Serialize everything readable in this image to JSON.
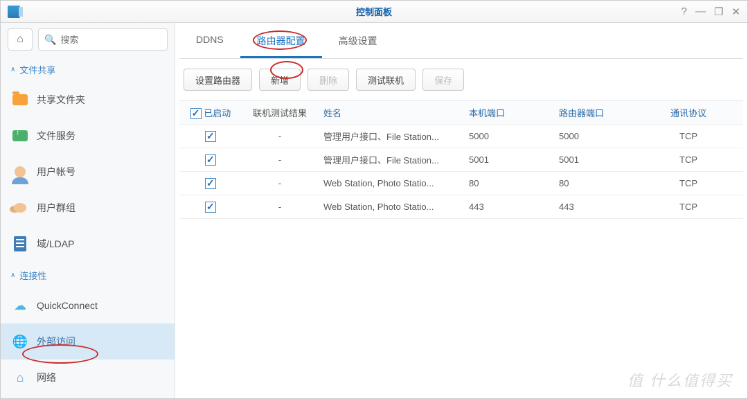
{
  "window": {
    "title": "控制面板"
  },
  "titlebar_icons": {
    "help": "?",
    "minimize": "—",
    "maximize": "❐",
    "close": "✕"
  },
  "sidebar": {
    "search_placeholder": "搜索",
    "section1": "文件共享",
    "items1": [
      {
        "label": "共享文件夹"
      },
      {
        "label": "文件服务"
      },
      {
        "label": "用户帐号"
      },
      {
        "label": "用户群组"
      },
      {
        "label": "域/LDAP"
      }
    ],
    "section2": "连接性",
    "items2": [
      {
        "label": "QuickConnect"
      },
      {
        "label": "外部访问",
        "active": true
      },
      {
        "label": "网络"
      }
    ]
  },
  "tabs": [
    {
      "label": "DDNS"
    },
    {
      "label": "路由器配置",
      "active": true
    },
    {
      "label": "高级设置"
    }
  ],
  "toolbar": {
    "setup": "设置路由器",
    "add": "新增",
    "delete": "删除",
    "test": "测试联机",
    "save": "保存"
  },
  "columns": {
    "enabled": "已启动",
    "test_result": "联机测试结果",
    "name": "姓名",
    "local_port": "本机端口",
    "router_port": "路由器端口",
    "protocol": "通讯协议"
  },
  "rows": [
    {
      "enabled": true,
      "test": "-",
      "name": "管理用户接口、File Station...",
      "lport": "5000",
      "rport": "5000",
      "proto": "TCP"
    },
    {
      "enabled": true,
      "test": "-",
      "name": "管理用户接口、File Station...",
      "lport": "5001",
      "rport": "5001",
      "proto": "TCP"
    },
    {
      "enabled": true,
      "test": "-",
      "name": "Web Station, Photo Statio...",
      "lport": "80",
      "rport": "80",
      "proto": "TCP"
    },
    {
      "enabled": true,
      "test": "-",
      "name": "Web Station, Photo Statio...",
      "lport": "443",
      "rport": "443",
      "proto": "TCP"
    }
  ],
  "watermark": "值 什么值得买"
}
